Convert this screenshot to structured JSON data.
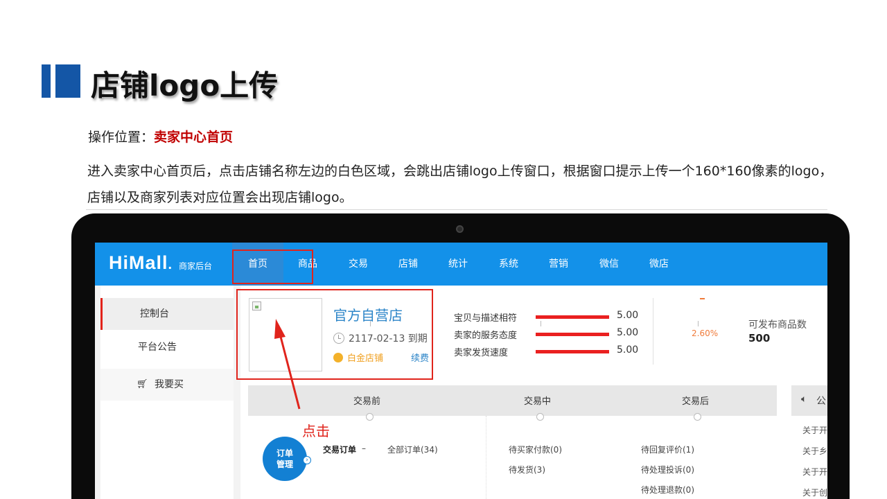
{
  "slide": {
    "title": "店铺logo上传",
    "op_label": "操作位置：",
    "op_value": "卖家中心首页",
    "description": "进入卖家中心首页后，点击店铺名称左边的白色区域，会跳出店铺logo上传窗口，根据窗口提示上传一个160*160像素的logo，店铺以及商家列表对应位置会出现店铺logo。",
    "click_label": "点击"
  },
  "app": {
    "logo": "HiMall",
    "logo_dot": ".",
    "logo_sub": "商家后台",
    "nav": [
      "首页",
      "商品",
      "交易",
      "店铺",
      "统计",
      "系统",
      "营销",
      "微信",
      "微店"
    ],
    "sidebar": {
      "items": [
        "控制台",
        "平台公告"
      ],
      "buy": "我要买"
    },
    "store": {
      "name": "官方自营店",
      "expire": "2117-02-13 到期",
      "level": "白金店铺",
      "renew": "续费"
    },
    "ratings": [
      {
        "label": "宝贝与描述相符",
        "value": "5.00"
      },
      {
        "label": "卖家的服务态度",
        "value": "5.00"
      },
      {
        "label": "卖家发货速度",
        "value": "5.00"
      }
    ],
    "percent": "2.60%",
    "available": {
      "label": "可发布商品数",
      "value": "500"
    },
    "stages": [
      "交易前",
      "交易中",
      "交易后"
    ],
    "notice_icon": "speaker-icon",
    "notice_head": "公",
    "notice_items": [
      "关于开",
      "关于乡",
      "关于开",
      "关于创"
    ],
    "order_circle": "订单管理",
    "orders": {
      "label": "交易订单",
      "dash": "–",
      "all": "全部订单(34)",
      "mid": [
        "待买家付款(0)",
        "待发货(3)"
      ],
      "after": [
        "待回复评价(1)",
        "待处理投诉(0)",
        "待处理退款(0)"
      ]
    }
  },
  "colors": {
    "nav_bg": "#1391e9",
    "accent_red": "#e0241c",
    "title_mark": "#1456a6",
    "link_blue": "#2c85c8"
  }
}
